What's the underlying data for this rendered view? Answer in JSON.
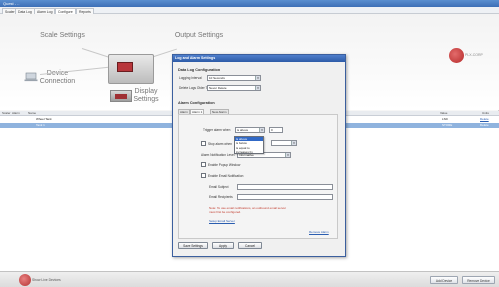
{
  "app": {
    "title": "Quest - .."
  },
  "tabs": [
    {
      "label": "Scaler"
    },
    {
      "label": "Data Log"
    },
    {
      "label": "Alarm Log"
    },
    {
      "label": "Configure"
    },
    {
      "label": "Reports"
    }
  ],
  "diagram": {
    "scale_settings": "Scale Settings",
    "output_settings": "Output Settings",
    "device_connection": "Device Connection",
    "display_settings": "Display Settings"
  },
  "logo": {
    "text": "PLX-CORP"
  },
  "grid": {
    "headers": [
      "Scaler",
      "Alarm",
      "Name",
      "Value",
      "Units"
    ],
    "rows": [
      {
        "name": "Wheel Tank",
        "value": "LSD",
        "action": "Delete"
      },
      {
        "name": "Tank 1",
        "value": "STORE",
        "action": "Delete"
      }
    ]
  },
  "dialog": {
    "title": "Log and Alarm Settings",
    "data_log": {
      "heading": "Data Log Configuration",
      "logging_interval_label": "Logging Interval",
      "logging_interval_value": "10 Seconds",
      "delete_logs_label": "Delete Logs Older Than",
      "delete_logs_value": "Never Delete"
    },
    "alarm": {
      "heading": "Alarm Configuration",
      "tabs": [
        "Alarm",
        "Alarm 1",
        "Alarm 2",
        "New Alarm"
      ],
      "trigger_label": "Trigger alarm when",
      "trigger_value": "is above",
      "trigger_amount": "0",
      "dropdown_options": [
        "is above",
        "is below",
        "is equal to",
        "increases by",
        "decreases by"
      ],
      "stop_label": "Stop alarm when",
      "notification_label": "Alarm Notification Level",
      "notification_value": "Informative",
      "popup_label": "Enable Popup Window",
      "email_label": "Enable Email Notification",
      "email_subject_label": "Email Subject",
      "email_recipients_label": "Email Recipients",
      "note": "Note: To use email notifications, an outbound email server must first be configured.",
      "setup_link": "Setup Email Server",
      "remove_link": "Remove Alarm"
    },
    "buttons": {
      "save": "Save Settings",
      "apply": "Apply",
      "cancel": "Cancel"
    }
  },
  "status": {
    "text": "Show Live Devices",
    "btn_add": "Add Device",
    "btn_remove": "Remove Device"
  },
  "colors": {
    "titlebar": "#3d6fb6",
    "selected_row": "#8fb3de",
    "logo": "#b52a2a"
  }
}
